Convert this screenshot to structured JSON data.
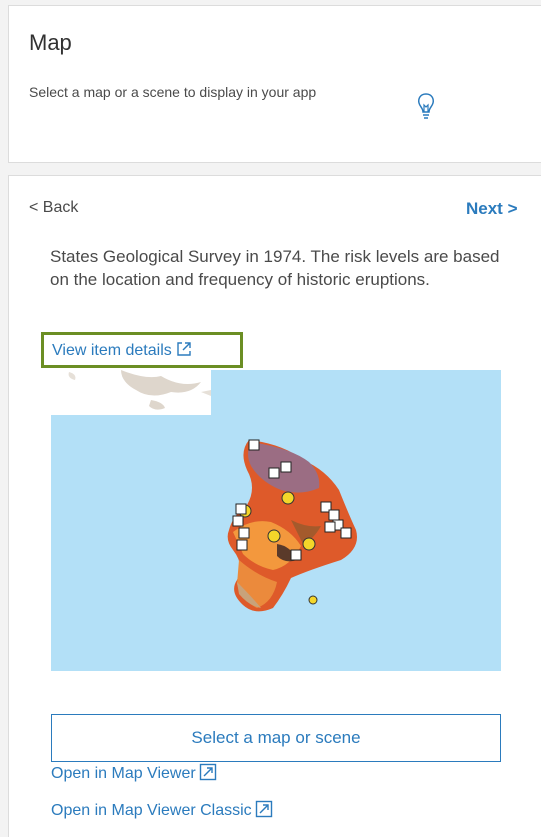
{
  "header": {
    "title": "Map",
    "description": "Select a map or a scene to display in your app"
  },
  "nav": {
    "back_label": "< Back",
    "next_label": "Next >"
  },
  "item": {
    "description": "States Geological Survey in 1974. The risk levels are based on the location and frequency of historic eruptions.",
    "view_details_label": "View item details"
  },
  "actions": {
    "select_label": "Select a map or scene",
    "open_map_viewer_label": "Open in Map Viewer",
    "open_map_viewer_classic_label": "Open in Map Viewer Classic"
  },
  "colors": {
    "link": "#2b7bbd",
    "highlight_border": "#6b8e23",
    "ocean": "#b3e0f7"
  },
  "icons": [
    "lightbulb-icon",
    "external-link-icon",
    "open-map-icon"
  ]
}
